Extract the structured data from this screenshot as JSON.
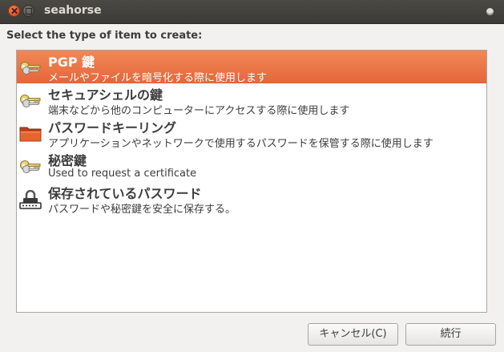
{
  "window": {
    "title": "seahorse"
  },
  "dialog": {
    "prompt": "Select the type of item to create:"
  },
  "items": [
    {
      "name": "PGP 鍵",
      "description": "メールやファイルを暗号化する際に使用します",
      "icon": "key-icon",
      "selected": true
    },
    {
      "name": "セキュアシェルの鍵",
      "description": "端末などから他のコンピューターにアクセスする際に使用します",
      "icon": "key-icon",
      "selected": false
    },
    {
      "name": "パスワードキーリング",
      "description": "アプリケーションやネットワークで使用するパスワードを保管する際に使用します",
      "icon": "folder-icon",
      "selected": false
    },
    {
      "name": "秘密鍵",
      "description": "Used to request a certificate",
      "icon": "key-icon",
      "selected": false
    },
    {
      "name": "保存されているパスワード",
      "description": "パスワードや秘密鍵を安全に保存する。",
      "icon": "lock-icon",
      "selected": false
    }
  ],
  "buttons": {
    "cancel": "キャンセル(C)",
    "continue": "続行"
  }
}
